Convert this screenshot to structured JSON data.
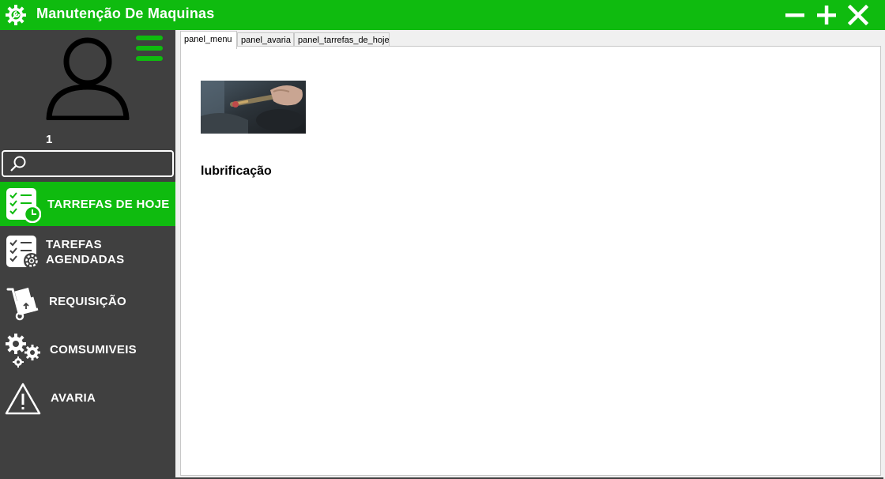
{
  "window": {
    "title": "Manutenção De Maquinas",
    "icons": {
      "app": "gear-wrench-icon",
      "minimize": "minus-icon",
      "maximize": "plus-icon",
      "close": "close-icon"
    }
  },
  "sidebar": {
    "user_number": "1",
    "search": {
      "value": "",
      "placeholder": ""
    },
    "items": [
      {
        "label": "TARREFAS        DE HOJE",
        "icon": "task-list-clock-icon",
        "active": true
      },
      {
        "label": "TAREFAS\nAGENDADAS",
        "icon": "task-list-gear-icon",
        "active": false
      },
      {
        "label": "REQUISIÇÃO",
        "icon": "hand-truck-icon",
        "active": false
      },
      {
        "label": "COMSUMIVEIS",
        "icon": "gears-icon",
        "active": false
      },
      {
        "label": "AVARIA",
        "icon": "warning-icon",
        "active": false
      }
    ]
  },
  "tabs": [
    {
      "label": "panel_menu",
      "active": true
    },
    {
      "label": "panel_avaria",
      "active": false
    },
    {
      "label": "panel_tarrefas_de_hoje",
      "active": false
    }
  ],
  "panel": {
    "item_label": "lubrificação",
    "image": "lubrication-photo"
  },
  "colors": {
    "accent": "#0fbb0f",
    "sidebar": "#404040",
    "panel": "#ffffff"
  }
}
